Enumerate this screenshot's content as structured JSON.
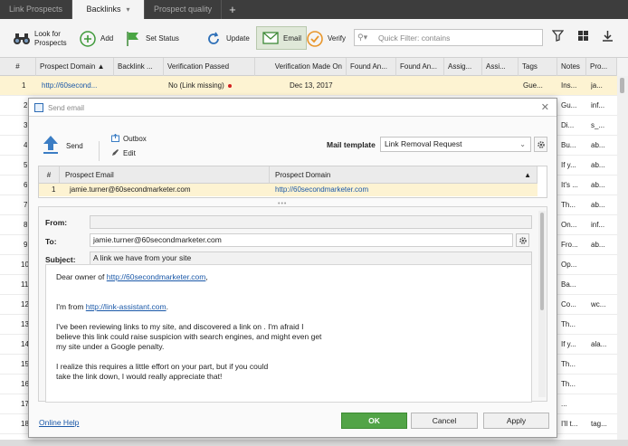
{
  "tabs": [
    {
      "label": "Link Prospects"
    },
    {
      "label": "Backlinks"
    },
    {
      "label": "Prospect quality"
    }
  ],
  "toolbar": {
    "look_for": "Look for\nProspects",
    "add": "Add",
    "set_status": "Set Status",
    "update": "Update",
    "email": "Email",
    "verify": "Verify",
    "filter_placeholder": "Quick Filter: contains"
  },
  "grid": {
    "headers": [
      "#",
      "Prospect Domain",
      "Backlink ...",
      "Verification Passed",
      "Verification Made On",
      "Found An...",
      "Found An...",
      "Assig...",
      "Assi...",
      "Tags",
      "Notes",
      "Pro..."
    ],
    "selected_row": {
      "num": "1",
      "domain": "http://60second...",
      "verification": "No (Link missing)",
      "date": "Dec 13, 2017",
      "tags": "Gue...",
      "notes": "Ins...",
      "pro": "ja..."
    },
    "rows": [
      {
        "num": "2",
        "notes": "Gu...",
        "pro": "inf..."
      },
      {
        "num": "3",
        "notes": "Di...",
        "pro": "s_..."
      },
      {
        "num": "4",
        "notes": "Bu...",
        "pro": "ab..."
      },
      {
        "num": "5",
        "notes": "If y...",
        "pro": "ab..."
      },
      {
        "num": "6",
        "notes": "It's ...",
        "pro": "ab..."
      },
      {
        "num": "7",
        "notes": "Th...",
        "pro": "ab..."
      },
      {
        "num": "8",
        "notes": "On...",
        "pro": "inf..."
      },
      {
        "num": "9",
        "notes": "Fro...",
        "pro": "ab..."
      },
      {
        "num": "10",
        "notes": "Op...",
        "pro": ""
      },
      {
        "num": "11",
        "notes": "Ba...",
        "pro": ""
      },
      {
        "num": "12",
        "notes": "Co...",
        "pro": "wc..."
      },
      {
        "num": "13",
        "notes": "Th...",
        "pro": ""
      },
      {
        "num": "14",
        "notes": "If y...",
        "pro": "ala..."
      },
      {
        "num": "15",
        "notes": "Th...",
        "pro": ""
      },
      {
        "num": "16",
        "notes": "Th...",
        "pro": ""
      },
      {
        "num": "17",
        "notes": "...",
        "pro": ""
      },
      {
        "num": "18",
        "notes": "I'll t...",
        "pro": "tag..."
      }
    ]
  },
  "dialog": {
    "title": "Send email",
    "send": "Send",
    "outbox": "Outbox",
    "edit": "Edit",
    "mail_template_label": "Mail template",
    "mail_template_value": "Link Removal Request",
    "recipients": {
      "headers": [
        "#",
        "Prospect Email",
        "Prospect Domain"
      ],
      "row": {
        "num": "1",
        "email": "jamie.turner@60secondmarketer.com",
        "domain": "http://60secondmarketer.com"
      }
    },
    "from_label": "From:",
    "from_value": "",
    "to_label": "To:",
    "to_value": "jamie.turner@60secondmarketer.com",
    "subject_label": "Subject:",
    "subject_value": "A link we have from your site",
    "body": {
      "greeting_prefix": "Dear owner of ",
      "greeting_link": "http://60secondmarketer.com",
      "greeting_suffix": ",",
      "intro_prefix": "I'm  from ",
      "intro_link": "http://link-assistant.com",
      "intro_suffix": ".",
      "para1": "I've been reviewing links to my site, and discovered a link on . I'm afraid I believe this link could raise suspicion with search engines, and might even get my site under a Google penalty.",
      "para2": "I realize this requires a little effort on your part, but if you could take the link down, I would really appreciate that!"
    },
    "help": "Online Help",
    "ok": "OK",
    "cancel": "Cancel",
    "apply": "Apply"
  },
  "colors": {
    "tabbar": "#3d3d3d",
    "link": "#1a58a8",
    "selected_row": "#fdf3d2",
    "ok_button": "#52a447",
    "status_dot": "#d32020"
  }
}
